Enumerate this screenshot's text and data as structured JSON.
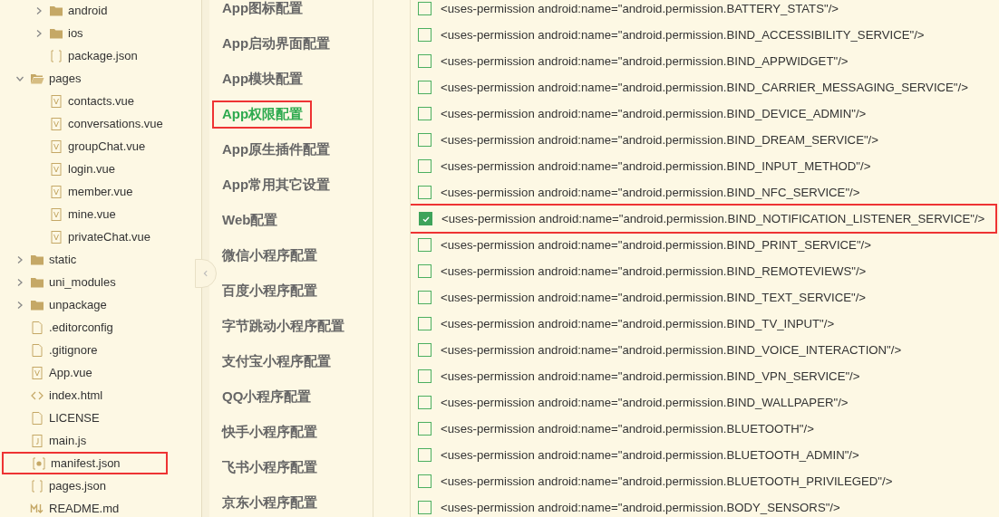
{
  "tree": [
    {
      "children": [
        {
          "label": "android",
          "kind": "folder",
          "expanded": false
        },
        {
          "label": "ios",
          "kind": "folder",
          "expanded": false
        },
        {
          "label": "package.json",
          "kind": "json"
        }
      ]
    },
    {
      "label": "pages",
      "kind": "folder",
      "expanded": true,
      "children": [
        {
          "label": "contacts.vue",
          "kind": "vue"
        },
        {
          "label": "conversations.vue",
          "kind": "vue"
        },
        {
          "label": "groupChat.vue",
          "kind": "vue"
        },
        {
          "label": "login.vue",
          "kind": "vue"
        },
        {
          "label": "member.vue",
          "kind": "vue"
        },
        {
          "label": "mine.vue",
          "kind": "vue"
        },
        {
          "label": "privateChat.vue",
          "kind": "vue"
        }
      ]
    },
    {
      "label": "static",
      "kind": "folder",
      "expanded": false
    },
    {
      "label": "uni_modules",
      "kind": "folder",
      "expanded": false
    },
    {
      "label": "unpackage",
      "kind": "folder",
      "expanded": false
    },
    {
      "label": ".editorconfig",
      "kind": "file"
    },
    {
      "label": ".gitignore",
      "kind": "file"
    },
    {
      "label": "App.vue",
      "kind": "vue"
    },
    {
      "label": "index.html",
      "kind": "html"
    },
    {
      "label": "LICENSE",
      "kind": "file"
    },
    {
      "label": "main.js",
      "kind": "js"
    },
    {
      "label": "manifest.json",
      "kind": "manifest",
      "highlighted": true
    },
    {
      "label": "pages.json",
      "kind": "json"
    },
    {
      "label": "README.md",
      "kind": "md"
    }
  ],
  "nav": [
    {
      "label": "App图标配置",
      "selected": false
    },
    {
      "label": "App启动界面配置",
      "selected": false
    },
    {
      "label": "App模块配置",
      "selected": false
    },
    {
      "label": "App权限配置",
      "selected": true,
      "highlighted": true
    },
    {
      "label": "App原生插件配置",
      "selected": false
    },
    {
      "label": "App常用其它设置",
      "selected": false
    },
    {
      "label": "Web配置",
      "selected": false
    },
    {
      "label": "微信小程序配置",
      "selected": false
    },
    {
      "label": "百度小程序配置",
      "selected": false
    },
    {
      "label": "字节跳动小程序配置",
      "selected": false
    },
    {
      "label": "支付宝小程序配置",
      "selected": false
    },
    {
      "label": "QQ小程序配置",
      "selected": false
    },
    {
      "label": "快手小程序配置",
      "selected": false
    },
    {
      "label": "飞书小程序配置",
      "selected": false
    },
    {
      "label": "京东小程序配置",
      "selected": false
    }
  ],
  "permissions": [
    {
      "text": "<uses-permission android:name=\"android.permission.BATTERY_STATS\"/>",
      "checked": false
    },
    {
      "text": "<uses-permission android:name=\"android.permission.BIND_ACCESSIBILITY_SERVICE\"/>",
      "checked": false
    },
    {
      "text": "<uses-permission android:name=\"android.permission.BIND_APPWIDGET\"/>",
      "checked": false
    },
    {
      "text": "<uses-permission android:name=\"android.permission.BIND_CARRIER_MESSAGING_SERVICE\"/>",
      "checked": false
    },
    {
      "text": "<uses-permission android:name=\"android.permission.BIND_DEVICE_ADMIN\"/>",
      "checked": false
    },
    {
      "text": "<uses-permission android:name=\"android.permission.BIND_DREAM_SERVICE\"/>",
      "checked": false
    },
    {
      "text": "<uses-permission android:name=\"android.permission.BIND_INPUT_METHOD\"/>",
      "checked": false
    },
    {
      "text": "<uses-permission android:name=\"android.permission.BIND_NFC_SERVICE\"/>",
      "checked": false
    },
    {
      "text": "<uses-permission android:name=\"android.permission.BIND_NOTIFICATION_LISTENER_SERVICE\"/>",
      "checked": true,
      "highlighted": true
    },
    {
      "text": "<uses-permission android:name=\"android.permission.BIND_PRINT_SERVICE\"/>",
      "checked": false
    },
    {
      "text": "<uses-permission android:name=\"android.permission.BIND_REMOTEVIEWS\"/>",
      "checked": false
    },
    {
      "text": "<uses-permission android:name=\"android.permission.BIND_TEXT_SERVICE\"/>",
      "checked": false
    },
    {
      "text": "<uses-permission android:name=\"android.permission.BIND_TV_INPUT\"/>",
      "checked": false
    },
    {
      "text": "<uses-permission android:name=\"android.permission.BIND_VOICE_INTERACTION\"/>",
      "checked": false
    },
    {
      "text": "<uses-permission android:name=\"android.permission.BIND_VPN_SERVICE\"/>",
      "checked": false
    },
    {
      "text": "<uses-permission android:name=\"android.permission.BIND_WALLPAPER\"/>",
      "checked": false
    },
    {
      "text": "<uses-permission android:name=\"android.permission.BLUETOOTH\"/>",
      "checked": false
    },
    {
      "text": "<uses-permission android:name=\"android.permission.BLUETOOTH_ADMIN\"/>",
      "checked": false
    },
    {
      "text": "<uses-permission android:name=\"android.permission.BLUETOOTH_PRIVILEGED\"/>",
      "checked": false
    },
    {
      "text": "<uses-permission android:name=\"android.permission.BODY_SENSORS\"/>",
      "checked": false
    }
  ]
}
